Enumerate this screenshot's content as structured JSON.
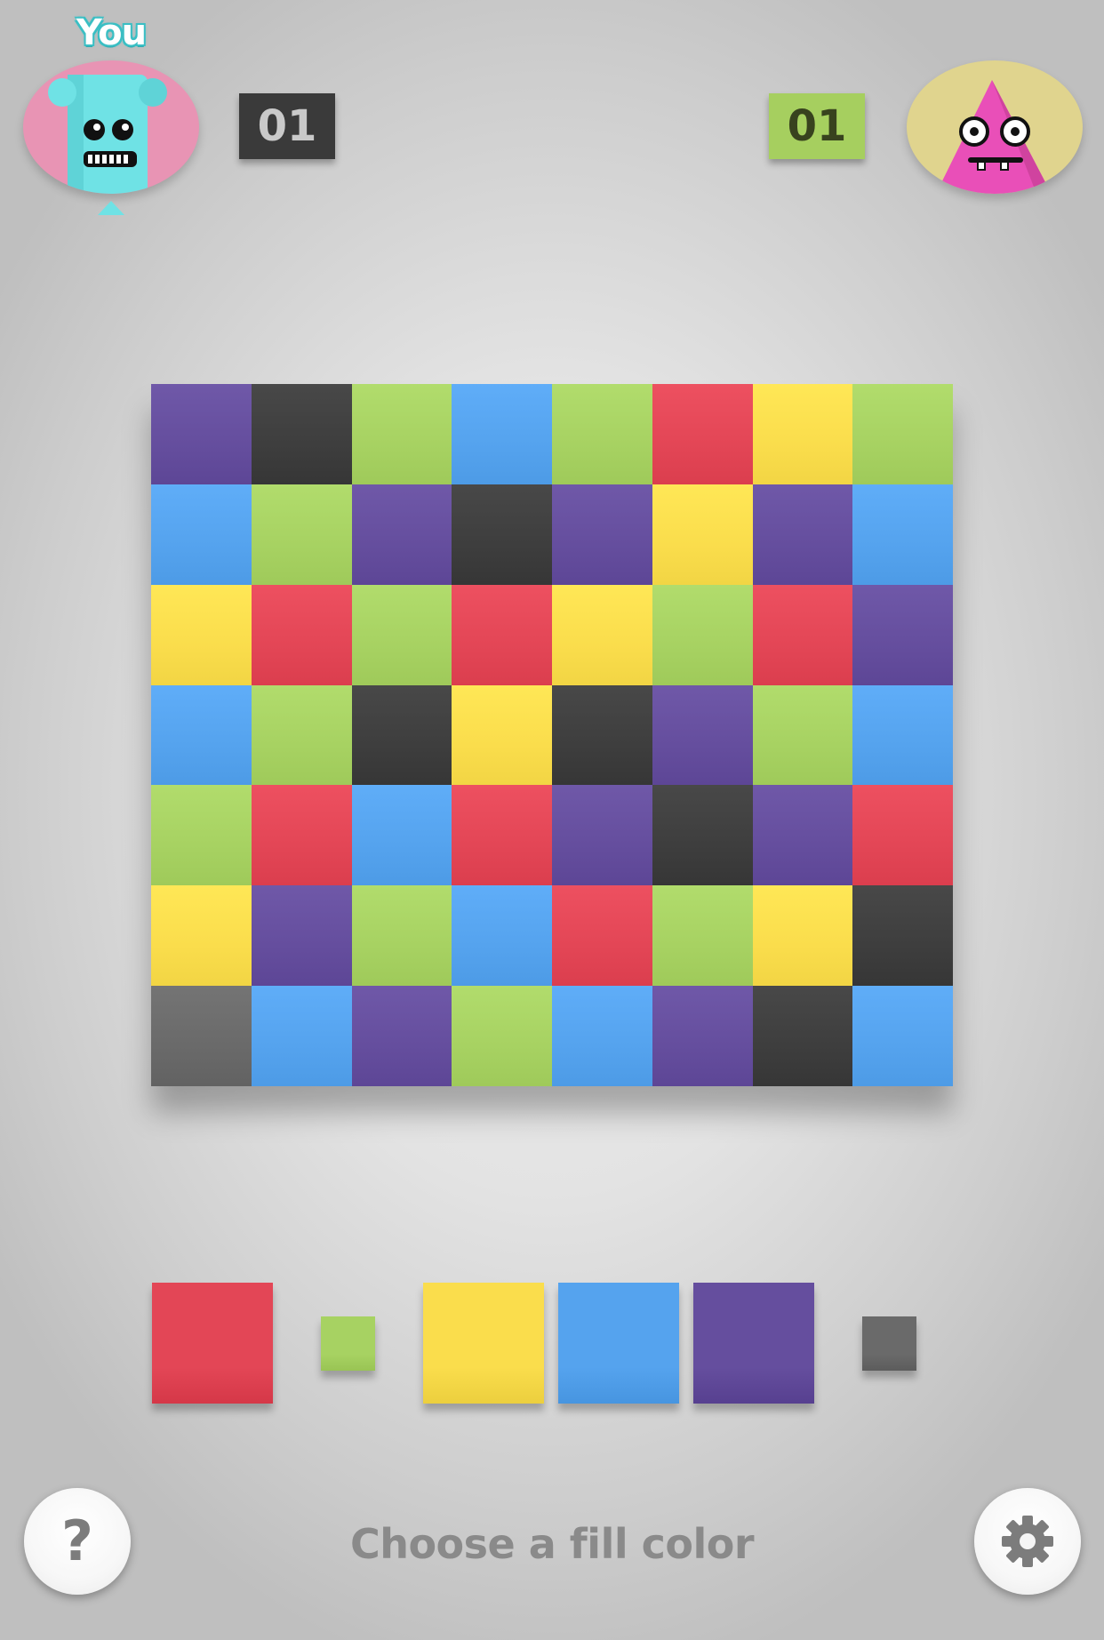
{
  "player1": {
    "label": "You",
    "score": "01",
    "avatar_icon": "cyan-monster-icon",
    "avatar_bg": "#e894b4"
  },
  "player2": {
    "score": "01",
    "avatar_icon": "pink-triangle-monster-icon",
    "avatar_bg": "#e0d48e"
  },
  "colors": {
    "red": "#e34656",
    "green": "#a7d262",
    "yellow": "#fadd4c",
    "blue": "#55a3ee",
    "purple": "#654e9e",
    "black": "#3e3e3e",
    "gray": "#6a6a6a"
  },
  "board": {
    "rows": [
      [
        "purple",
        "black",
        "green",
        "blue",
        "green",
        "red",
        "yellow",
        "green"
      ],
      [
        "blue",
        "green",
        "purple",
        "black",
        "purple",
        "yellow",
        "purple",
        "blue"
      ],
      [
        "yellow",
        "red",
        "green",
        "red",
        "yellow",
        "green",
        "red",
        "purple"
      ],
      [
        "blue",
        "green",
        "black",
        "yellow",
        "black",
        "purple",
        "green",
        "blue"
      ],
      [
        "green",
        "red",
        "blue",
        "red",
        "purple",
        "black",
        "purple",
        "red"
      ],
      [
        "yellow",
        "purple",
        "green",
        "blue",
        "red",
        "green",
        "yellow",
        "black"
      ],
      [
        "gray",
        "blue",
        "purple",
        "green",
        "blue",
        "purple",
        "black",
        "blue"
      ]
    ]
  },
  "palette": {
    "options": [
      {
        "color": "red",
        "state": "available"
      },
      {
        "color": "green",
        "state": "taken"
      },
      {
        "color": "yellow",
        "state": "available"
      },
      {
        "color": "blue",
        "state": "available"
      },
      {
        "color": "purple",
        "state": "available"
      },
      {
        "color": "gray",
        "state": "taken"
      }
    ]
  },
  "status_text": "Choose a fill color",
  "help_label": "?",
  "controls": {
    "help_icon": "question-mark-icon",
    "settings_icon": "gear-icon"
  }
}
